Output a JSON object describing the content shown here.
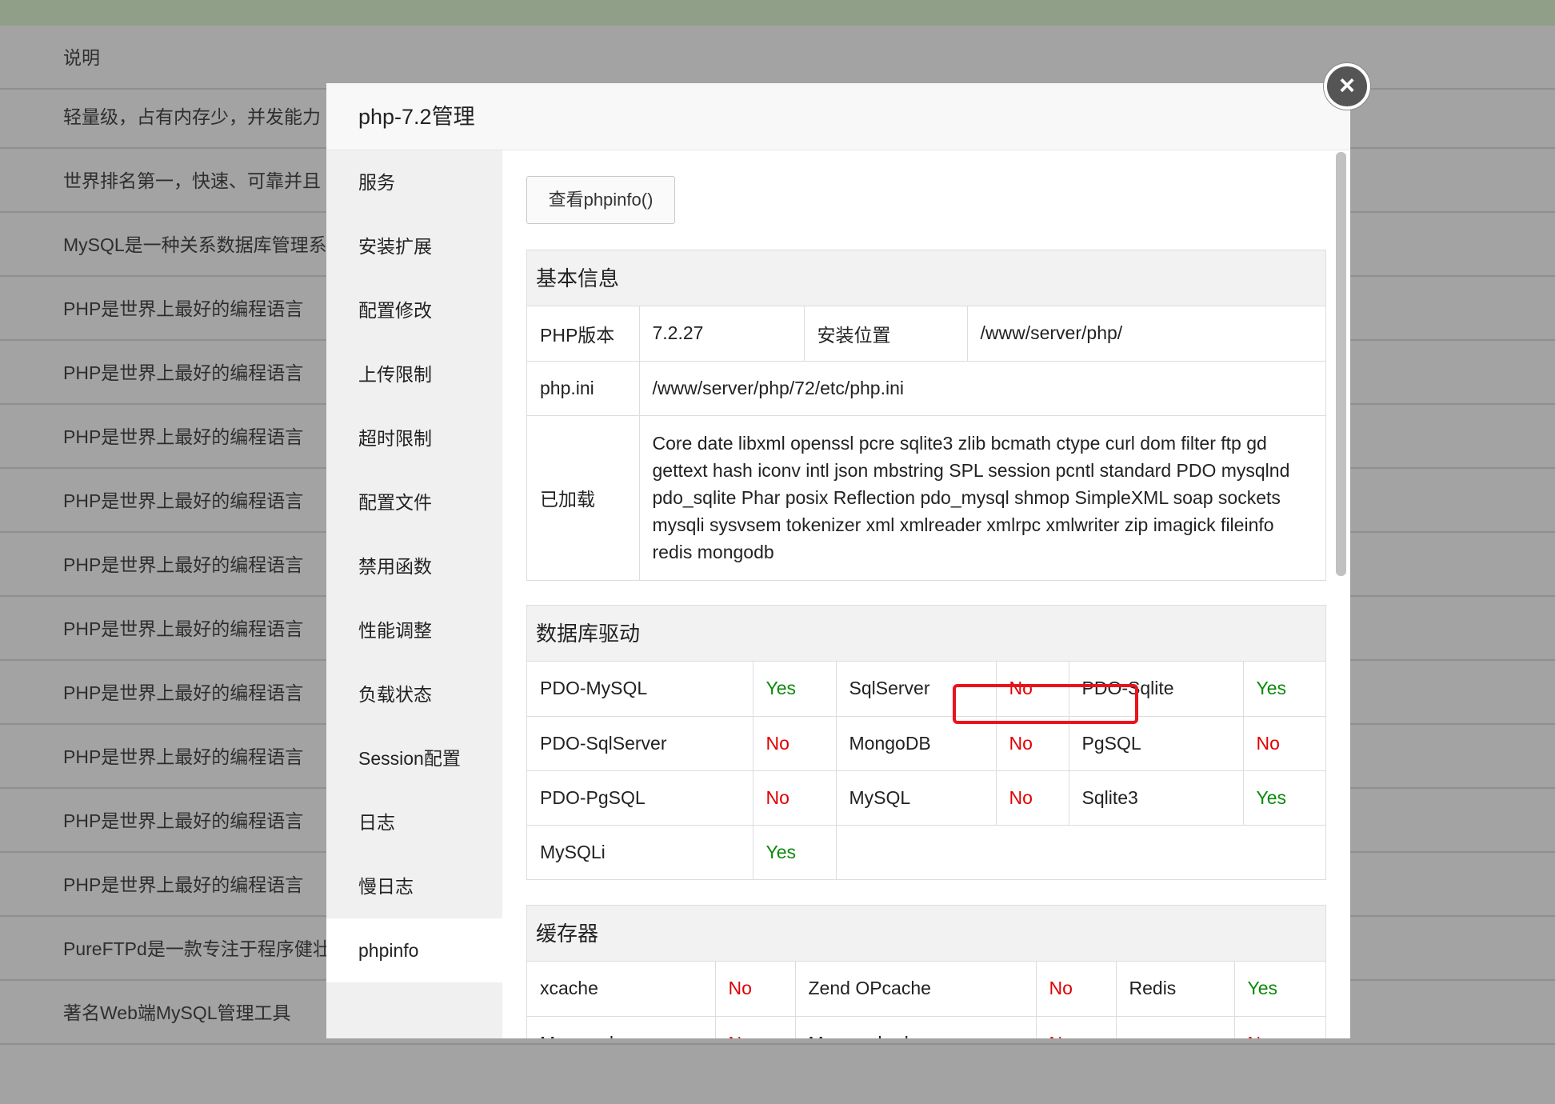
{
  "background": {
    "rows": [
      "说明",
      "轻量级，占有内存少，并发能力",
      "世界排名第一，快速、可靠并且",
      "MySQL是一种关系数据库管理系",
      "PHP是世界上最好的编程语言",
      "PHP是世界上最好的编程语言",
      "PHP是世界上最好的编程语言",
      "PHP是世界上最好的编程语言",
      "PHP是世界上最好的编程语言",
      "PHP是世界上最好的编程语言",
      "PHP是世界上最好的编程语言",
      "PHP是世界上最好的编程语言",
      "PHP是世界上最好的编程语言",
      "PHP是世界上最好的编程语言",
      "PureFTPd是一款专注于程序健壮",
      "著名Web端MySQL管理工具"
    ]
  },
  "modal": {
    "title": "php-7.2管理",
    "close_label": "×"
  },
  "sidebar": {
    "items": [
      {
        "label": "服务"
      },
      {
        "label": "安装扩展"
      },
      {
        "label": "配置修改"
      },
      {
        "label": "上传限制"
      },
      {
        "label": "超时限制"
      },
      {
        "label": "配置文件"
      },
      {
        "label": "禁用函数"
      },
      {
        "label": "性能调整"
      },
      {
        "label": "负载状态"
      },
      {
        "label": "Session配置"
      },
      {
        "label": "日志"
      },
      {
        "label": "慢日志"
      },
      {
        "label": "phpinfo"
      }
    ],
    "active": "phpinfo"
  },
  "content": {
    "phpinfo_button": "查看phpinfo()",
    "basic": {
      "heading": "基本信息",
      "php_version_label": "PHP版本",
      "php_version": "7.2.27",
      "install_path_label": "安装位置",
      "install_path": "/www/server/php/",
      "ini_label": "php.ini",
      "ini_path": "/www/server/php/72/etc/php.ini",
      "loaded_label": "已加载",
      "loaded_extensions": "Core date libxml openssl pcre sqlite3 zlib bcmath ctype curl dom filter ftp gd gettext hash iconv intl json mbstring SPL session pcntl standard PDO mysqlnd pdo_sqlite Phar posix Reflection pdo_mysql shmop SimpleXML soap sockets mysqli sysvsem tokenizer xml xmlreader xmlrpc xmlwriter zip imagick fileinfo redis mongodb"
    },
    "db": {
      "heading": "数据库驱动",
      "rows": [
        [
          {
            "name": "PDO-MySQL",
            "status": "Yes"
          },
          {
            "name": "SqlServer",
            "status": "No"
          },
          {
            "name": "PDO-Sqlite",
            "status": "Yes"
          }
        ],
        [
          {
            "name": "PDO-SqlServer",
            "status": "No"
          },
          {
            "name": "MongoDB",
            "status": "No"
          },
          {
            "name": "PgSQL",
            "status": "No"
          }
        ],
        [
          {
            "name": "PDO-PgSQL",
            "status": "No"
          },
          {
            "name": "MySQL",
            "status": "No"
          },
          {
            "name": "Sqlite3",
            "status": "Yes"
          }
        ],
        [
          {
            "name": "MySQLi",
            "status": "Yes"
          }
        ]
      ]
    },
    "cache": {
      "heading": "缓存器",
      "rows": [
        [
          {
            "name": "xcache",
            "status": "No"
          },
          {
            "name": "Zend OPcache",
            "status": "No"
          },
          {
            "name": "Redis",
            "status": "Yes"
          }
        ],
        [
          {
            "name": "Memcache",
            "status": "No"
          },
          {
            "name": "Memcached",
            "status": "No"
          },
          {
            "name": "apcu",
            "status": "No"
          }
        ]
      ]
    }
  },
  "colors": {
    "yes": "#0a8a0a",
    "no": "#e00000",
    "highlight": "#e8141c"
  }
}
